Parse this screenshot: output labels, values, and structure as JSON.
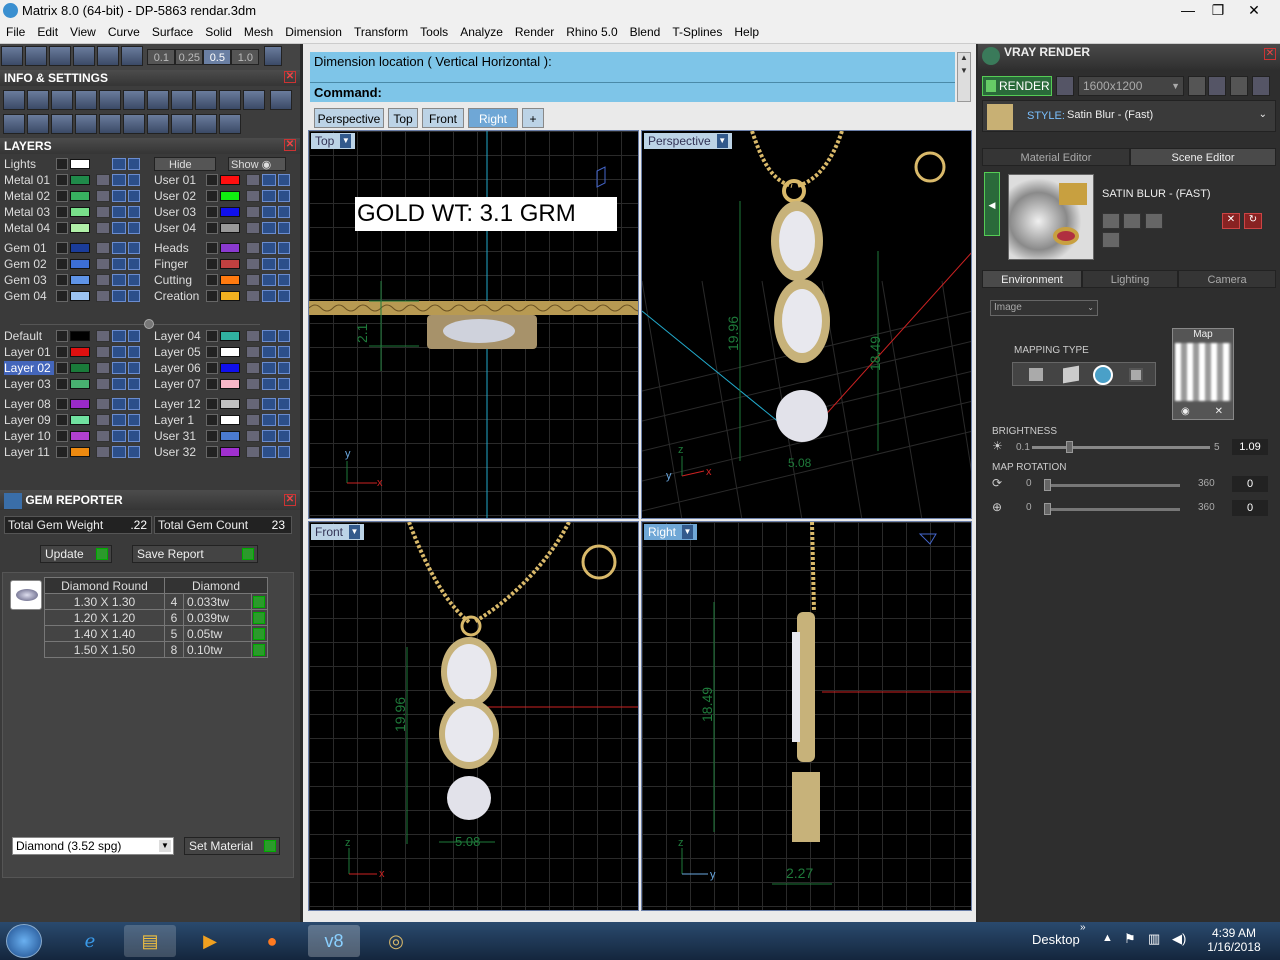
{
  "window": {
    "title": "Matrix 8.0 (64-bit) - DP-5863 rendar.3dm",
    "minimize": "—",
    "maximize": "❐",
    "close": "✕"
  },
  "menu": [
    "File",
    "Edit",
    "View",
    "Curve",
    "Surface",
    "Solid",
    "Mesh",
    "Dimension",
    "Transform",
    "Tools",
    "Analyze",
    "Render",
    "Rhino 5.0",
    "Blend",
    "T-Splines",
    "Help"
  ],
  "snap_values": [
    "0.1",
    "0.25",
    "0.5",
    "1.0"
  ],
  "info_settings": {
    "title": "INFO & SETTINGS"
  },
  "layers": {
    "title": "LAYERS",
    "lights_label": "Lights",
    "hide_label": "Hide",
    "show_label": "Show",
    "left_col": [
      {
        "name": "Metal 01",
        "color": "#1f8a4a"
      },
      {
        "name": "Metal 02",
        "color": "#38b060"
      },
      {
        "name": "Metal 03",
        "color": "#78e08a"
      },
      {
        "name": "Metal 04",
        "color": "#b0f0a8"
      },
      {
        "name": "Gem 01",
        "color": "#1a3c9a"
      },
      {
        "name": "Gem 02",
        "color": "#3c6ed6"
      },
      {
        "name": "Gem 03",
        "color": "#5f94e8"
      },
      {
        "name": "Gem 04",
        "color": "#9cc4f2"
      },
      {
        "name": "Default",
        "color": "#000000"
      },
      {
        "name": "Layer 01",
        "color": "#e01010"
      },
      {
        "name": "Layer 02",
        "color": "#1a7a3a"
      },
      {
        "name": "Layer 03",
        "color": "#48b070"
      },
      {
        "name": "Layer 08",
        "color": "#9a2ac8"
      },
      {
        "name": "Layer 09",
        "color": "#70e0a0"
      },
      {
        "name": "Layer 10",
        "color": "#b040d0"
      },
      {
        "name": "Layer 11",
        "color": "#ee8a10"
      }
    ],
    "right_col": [
      {
        "name": "User 01",
        "color": "#ff1010"
      },
      {
        "name": "User 02",
        "color": "#10ee10"
      },
      {
        "name": "User 03",
        "color": "#1010ee"
      },
      {
        "name": "User 04",
        "color": "#999999"
      },
      {
        "name": "Heads",
        "color": "#8a3ad0"
      },
      {
        "name": "Finger",
        "color": "#c04040"
      },
      {
        "name": "Cutting",
        "color": "#ff7a10"
      },
      {
        "name": "Creation",
        "color": "#f0b020"
      },
      {
        "name": "Layer 04",
        "color": "#30b0a0"
      },
      {
        "name": "Layer 05",
        "color": "#ffffff"
      },
      {
        "name": "Layer 06",
        "color": "#1010ee"
      },
      {
        "name": "Layer 07",
        "color": "#f8b8c8"
      },
      {
        "name": "Layer 12",
        "color": "#c0c0c0"
      },
      {
        "name": "Layer 1",
        "color": "#ffffff"
      },
      {
        "name": "User 31",
        "color": "#4a7ad0"
      },
      {
        "name": "User 32",
        "color": "#a030d0"
      }
    ]
  },
  "gem_reporter": {
    "title": "GEM REPORTER",
    "total_weight_label": "Total Gem Weight",
    "total_weight_value": ".22",
    "total_count_label": "Total Gem Count",
    "total_count_value": "23",
    "update_label": "Update",
    "save_report_label": "Save Report",
    "col_headers": [
      "Diamond Round",
      "Diamond"
    ],
    "rows": [
      {
        "size": "1.30 X 1.30",
        "count": "4",
        "weight": "0.033tw"
      },
      {
        "size": "1.20 X 1.20",
        "count": "6",
        "weight": "0.039tw"
      },
      {
        "size": "1.40 X 1.40",
        "count": "5",
        "weight": "0.05tw"
      },
      {
        "size": "1.50 X 1.50",
        "count": "8",
        "weight": "0.10tw"
      }
    ],
    "material_select": "Diamond    (3.52 spg)",
    "set_material_label": "Set Material"
  },
  "command": {
    "prompt": "Dimension location ( Vertical  Horizontal ):",
    "label": "Command:"
  },
  "viewport_tabs": [
    "Perspective",
    "Top",
    "Front",
    "Right",
    "+"
  ],
  "viewports": {
    "top": {
      "label": "Top",
      "annotation": "GOLD WT: 3.1 GRM",
      "dim": "2.1"
    },
    "perspective": {
      "label": "Perspective",
      "dims": [
        "19.96",
        "18.49",
        "5.08"
      ]
    },
    "front": {
      "label": "Front",
      "dims": [
        "19.96",
        "5.08"
      ]
    },
    "right": {
      "label": "Right",
      "dims": [
        "18.49",
        "2.27"
      ]
    }
  },
  "vray": {
    "title": "VRAY RENDER",
    "render_label": "RENDER",
    "resolution": "1600x1200",
    "style_label": "STYLE:",
    "style_value": "Satin Blur - (Fast)",
    "tabs": [
      "Material Editor",
      "Scene Editor"
    ],
    "material_name": "SATIN BLUR - (FAST)",
    "env_tabs": [
      "Environment",
      "Lighting",
      "Camera"
    ],
    "env_select": "Image",
    "map_label": "Map",
    "mapping_type_label": "MAPPING TYPE",
    "brightness_label": "BRIGHTNESS",
    "brightness_min": "0.1",
    "brightness_max": "5",
    "brightness_value": "1.09",
    "brightness_level": 0.2,
    "map_rotation_label": "MAP ROTATION",
    "rot1_min": "0",
    "rot1_max": "360",
    "rot1_value": "0",
    "rot2_min": "0",
    "rot2_max": "360",
    "rot2_value": "0"
  },
  "taskbar": {
    "desktop_label": "Desktop",
    "time": "4:39 AM",
    "date": "1/16/2018"
  },
  "colors": {
    "cmd_bg": "#7ec5e8",
    "gold": "#d9b96a",
    "dim_green": "#1e7a3a",
    "axis_red": "#cc2222",
    "axis_cyan": "#22aacc"
  }
}
